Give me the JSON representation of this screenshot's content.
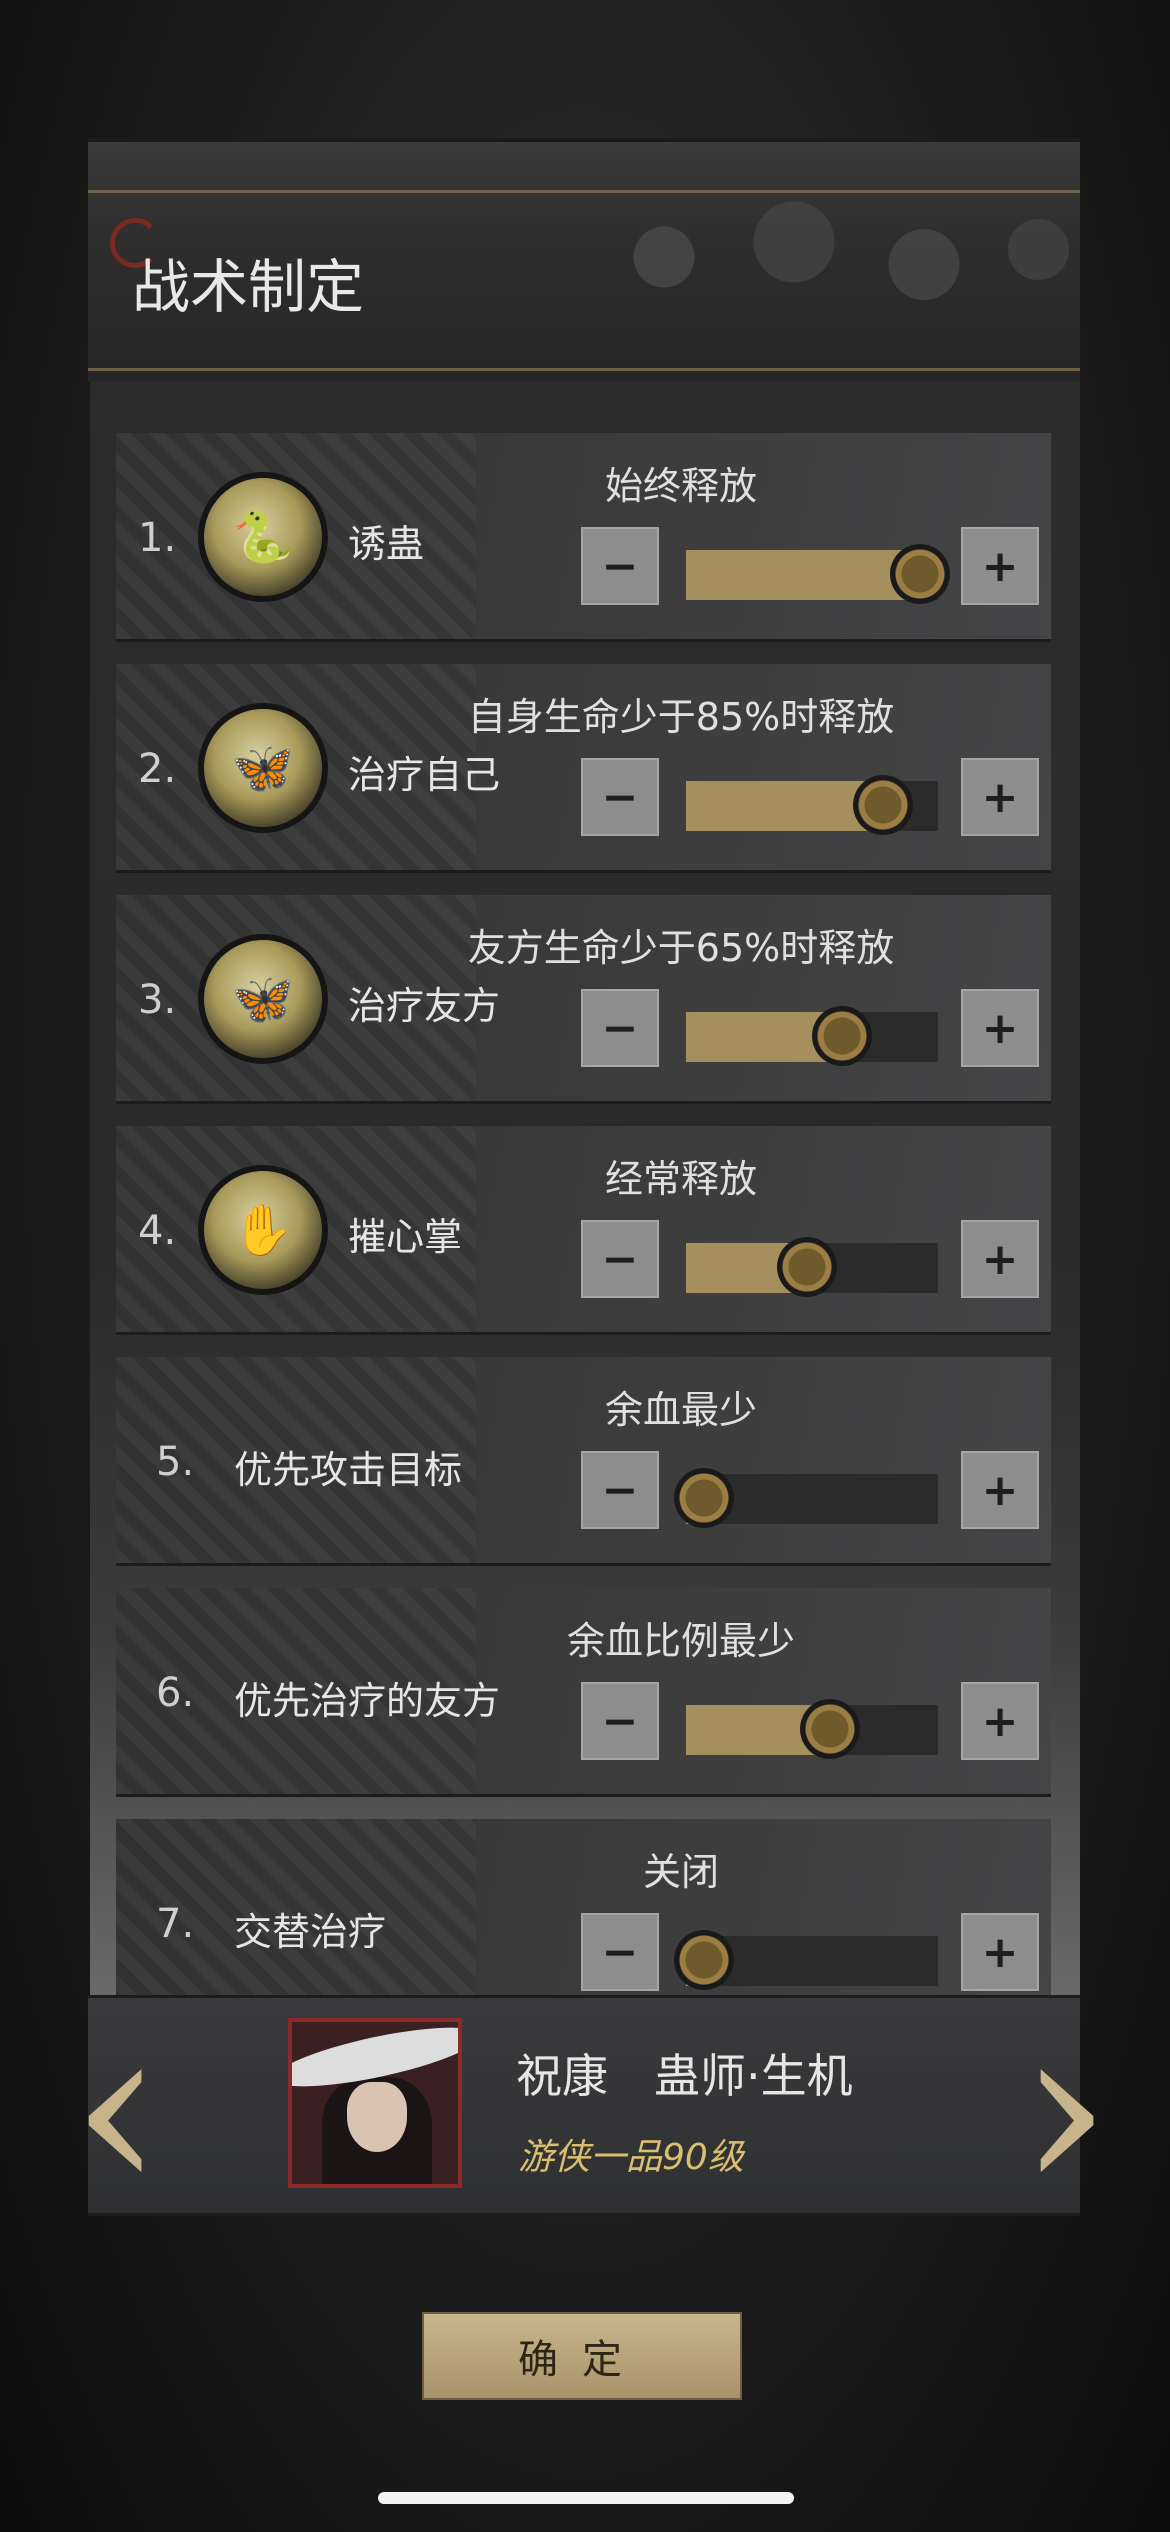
{
  "header": {
    "title": "战术制定"
  },
  "tactics": [
    {
      "number": "1.",
      "name": "诱蛊",
      "icon": "serpent-skill-icon",
      "option": "始终释放",
      "level": 0.93
    },
    {
      "number": "2.",
      "name": "治疗自己",
      "icon": "butterfly-heal-icon",
      "option": "自身生命少于85%时释放",
      "level": 0.78
    },
    {
      "number": "3.",
      "name": "治疗友方",
      "icon": "butterfly-heal-icon",
      "option": "友方生命少于65%时释放",
      "level": 0.62
    },
    {
      "number": "4.",
      "name": "摧心掌",
      "icon": "palm-strike-icon",
      "option": "经常释放",
      "level": 0.48
    },
    {
      "number": "5.",
      "name": "优先攻击目标",
      "option": "余血最少",
      "level": 0.05
    },
    {
      "number": "6.",
      "name": "优先治疗的友方",
      "option": "余血比例最少",
      "level": 0.57
    },
    {
      "number": "7.",
      "name": "交替治疗",
      "option": "关闭",
      "level": 0.05
    }
  ],
  "controls": {
    "minus": "−",
    "plus": "+"
  },
  "character": {
    "name": "祝康　蛊师·生机",
    "subtitle": "游侠一品90级",
    "prev": "‹",
    "next": "›"
  },
  "confirm_label": "确定",
  "colors": {
    "accent_gold": "#a68f5e",
    "subtitle_gold": "#d9bf6e"
  }
}
